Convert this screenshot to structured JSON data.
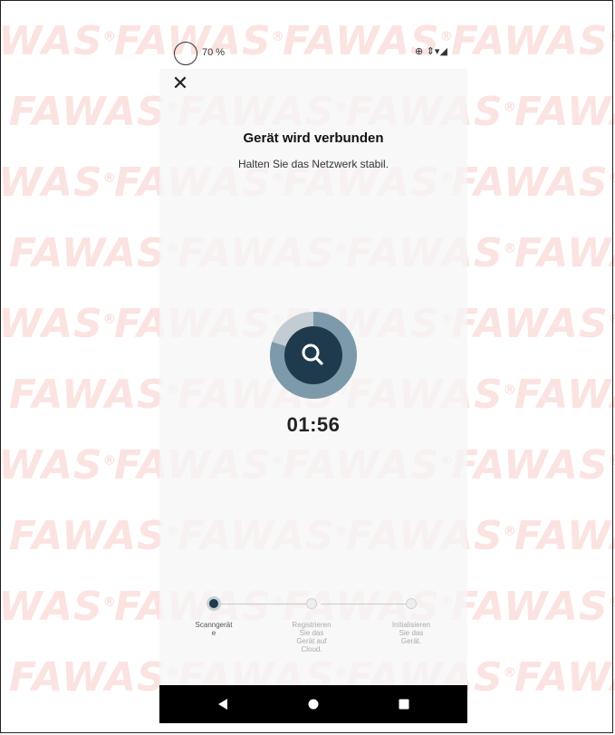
{
  "status_bar": {
    "battery": "70 %",
    "icons": "⊕ ⇕▾◢"
  },
  "dialog": {
    "close_glyph": "✕",
    "title": "Gerät wird verbunden",
    "subtitle": "Halten Sie das Netzwerk stabil.",
    "timer": "01:56",
    "scan_progress": 0.8,
    "icon": "search-icon"
  },
  "steps": [
    {
      "label_lines": [
        "Scanngerät",
        "e"
      ],
      "state": "active"
    },
    {
      "label_lines": [
        "Registrieren",
        "Sie das",
        "Gerät auf",
        "Cloud."
      ],
      "state": "pending"
    },
    {
      "label_lines": [
        "Initialisieren",
        "Sie das",
        "Gerät."
      ],
      "state": "pending"
    }
  ],
  "watermark": "FAWAS",
  "colors": {
    "accent": "#1f3a4c",
    "ring": "#7d9aaa",
    "watermark": "#fbe3e1"
  }
}
